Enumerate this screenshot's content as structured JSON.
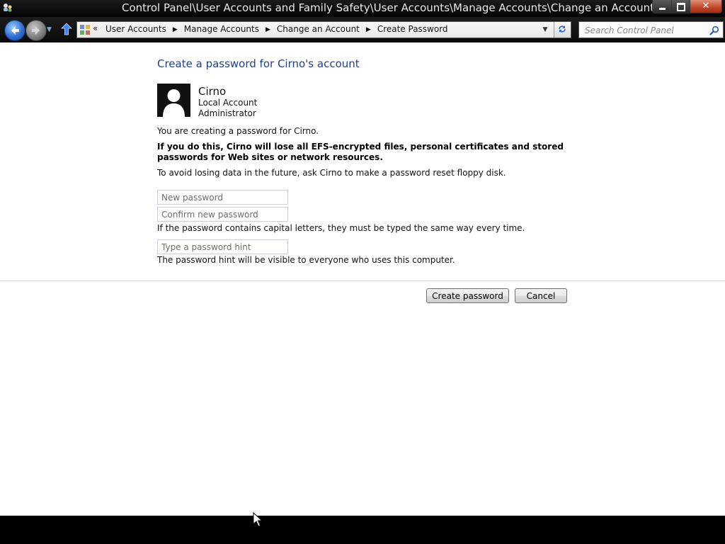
{
  "window": {
    "title": "Control Panel\\User Accounts and Family Safety\\User Accounts\\Manage Accounts\\Change an Account\\C",
    "controls": {
      "close": "✕"
    }
  },
  "address_bar": {
    "overflow": "«",
    "breadcrumbs": [
      "User Accounts",
      "Manage Accounts",
      "Change an Account",
      "Create Password"
    ],
    "separator": "▶",
    "dropdown": "▼"
  },
  "search": {
    "placeholder": "Search Control Panel"
  },
  "page": {
    "heading": "Create a password for Cirno's account",
    "user": {
      "name": "Cirno",
      "account_type": "Local Account",
      "role": "Administrator"
    },
    "intro": "You are creating a password for Cirno.",
    "warning": "If you do this, Cirno will lose all EFS-encrypted files, personal certificates and stored passwords for Web sites or network resources.",
    "advice": "To avoid losing data in the future, ask Cirno to make a password reset floppy disk.",
    "fields": {
      "new_password": {
        "placeholder": "New password",
        "value": ""
      },
      "confirm_password": {
        "placeholder": "Confirm new password",
        "value": ""
      },
      "hint": {
        "placeholder": "Type a password hint",
        "value": ""
      }
    },
    "caps_note": "If the password contains capital letters, they must be typed the same way every time.",
    "hint_note": "The password hint will be visible to everyone who uses this computer.",
    "buttons": {
      "create": "Create password",
      "cancel": "Cancel"
    }
  },
  "colors": {
    "heading": "#1f3f8f",
    "chrome": "#0a0a0a",
    "taskbar": "#000000"
  }
}
